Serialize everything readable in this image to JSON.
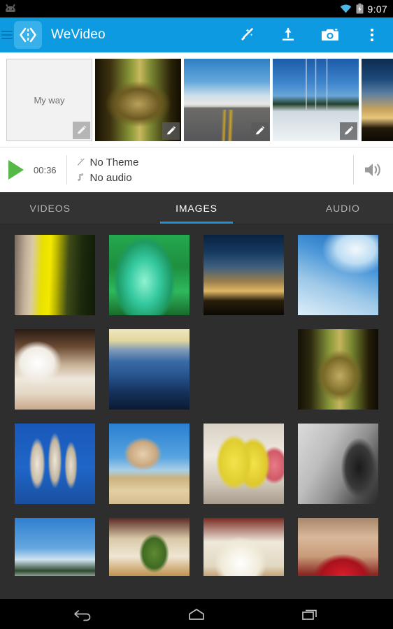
{
  "status_bar": {
    "time": "9:07",
    "icons": [
      "android-robot-icon",
      "wifi-icon",
      "battery-charging-icon"
    ]
  },
  "app_bar": {
    "title": "WeVideo",
    "drawer_icon": "hamburger-menu-icon",
    "logo_icon": "wevideo-logo-icon",
    "actions": [
      {
        "name": "magic-wand-icon",
        "label": "Theme"
      },
      {
        "name": "upload-icon",
        "label": "Upload"
      },
      {
        "name": "camera-icon",
        "label": "Camera"
      },
      {
        "name": "overflow-menu-icon",
        "label": "More options"
      }
    ]
  },
  "timeline": {
    "title_card": {
      "label": "My way",
      "edit_icon": "pencil-icon"
    },
    "clips": [
      {
        "name": "clip-forest-path",
        "photo": "p-forestpath",
        "edit_icon": "pencil-icon"
      },
      {
        "name": "clip-road-clouds",
        "photo": "p-road",
        "edit_icon": "pencil-icon"
      },
      {
        "name": "clip-snow-poles",
        "photo": "p-snowpoles",
        "edit_icon": "pencil-icon"
      },
      {
        "name": "clip-sunset-silhouette",
        "photo": "p-sunsetsil",
        "edit_icon": ""
      }
    ]
  },
  "controls": {
    "play_icon": "play-icon",
    "duration": "00:36",
    "theme": {
      "icon": "magic-wand-icon",
      "label": "No Theme"
    },
    "audio": {
      "icon": "music-note-icon",
      "label": "No audio"
    },
    "volume_icon": "volume-icon"
  },
  "tabs": {
    "items": [
      {
        "label": "VIDEOS",
        "active": false
      },
      {
        "label": "IMAGES",
        "active": true
      },
      {
        "label": "AUDIO",
        "active": false
      }
    ],
    "indicator_color": "#1f8fd0"
  },
  "media_grid": {
    "items": [
      {
        "name": "thumb-yellow-moss-bark",
        "photo": "p-mossbark"
      },
      {
        "name": "thumb-green-aloe-grass",
        "photo": "p-aloe"
      },
      {
        "name": "thumb-sunset-plant-silhouette",
        "photo": "p-sunsetplant"
      },
      {
        "name": "thumb-blossoms-blue-sky",
        "photo": "p-blossomsky"
      },
      {
        "name": "thumb-cappuccino-cup",
        "photo": "p-coffee"
      },
      {
        "name": "thumb-blue-fog-pylon",
        "photo": "p-fogpylon"
      },
      {
        "name": "thumb-hazy-sun-trees",
        "photo": "p-hazysun"
      },
      {
        "name": "thumb-forest-trail-trees",
        "photo": "p-trailtrees"
      },
      {
        "name": "thumb-blossom-branches-blue",
        "photo": "p-blossomblue"
      },
      {
        "name": "thumb-bare-tree-hill",
        "photo": "p-baretree"
      },
      {
        "name": "thumb-bananas-fruit-plate",
        "photo": "p-bananas"
      },
      {
        "name": "thumb-raindrops-glass",
        "photo": "p-raindrops"
      },
      {
        "name": "thumb-flags-ski-poles",
        "photo": "p-flagpoles"
      },
      {
        "name": "thumb-tea-cup-leaf",
        "photo": "p-teaLeaf"
      },
      {
        "name": "thumb-tea-cup-napkin",
        "photo": "p-teacup"
      },
      {
        "name": "thumb-red-table-setting",
        "photo": "p-redtable"
      }
    ]
  },
  "nav_bar": {
    "buttons": [
      {
        "name": "back-icon",
        "label": "Back"
      },
      {
        "name": "home-icon",
        "label": "Home"
      },
      {
        "name": "recents-icon",
        "label": "Recent apps"
      }
    ]
  },
  "colors": {
    "app_bar": "#0e9ae0",
    "logo_tile": "#38b0ea",
    "tab_bar": "#333333",
    "grid_background": "#2e2e2e",
    "play_green": "#56b947",
    "tab_indicator": "#1f8fd0"
  }
}
